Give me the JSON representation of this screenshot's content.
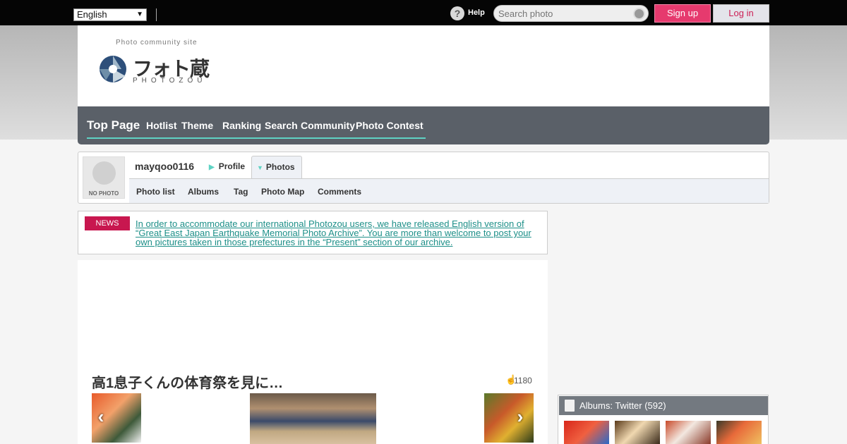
{
  "topbar": {
    "language": "English",
    "help_label": "Help",
    "search_placeholder": "Search photo",
    "signup_label": "Sign up",
    "login_label": "Log in"
  },
  "logo": {
    "tagline": "Photo community site",
    "title": "フォト蔵",
    "subtitle": "PHOTOZOU"
  },
  "nav": {
    "items": [
      "Top Page",
      "Hotlist",
      "Theme",
      "Ranking",
      "Search",
      "Community",
      "Photo Contest"
    ]
  },
  "profile": {
    "avatar_label": "NO PHOTO",
    "username": "mayqoo0116",
    "tabs": [
      "Profile",
      "Photos"
    ],
    "subnav": [
      "Photo list",
      "Albums",
      "Tag",
      "Photo Map",
      "Comments"
    ]
  },
  "news": {
    "badge": "NEWS",
    "text": "In order to accommodate our international Photozou users, we have released English version of “Great East Japan Earthquake Memorial Photo Archive”. You are more than welcome to post your own pictures taken in those prefectures in the “Present” section of our archive."
  },
  "photo": {
    "title": "高1息子くんの体育祭を見に…",
    "views": "1180"
  },
  "albums": {
    "header": "Albums: Twitter (592)"
  },
  "colors": {
    "accent": "#5fd3c4",
    "signup": "#e63a6e",
    "news_badge": "#c8174f",
    "nav_bg": "#5a6068"
  }
}
